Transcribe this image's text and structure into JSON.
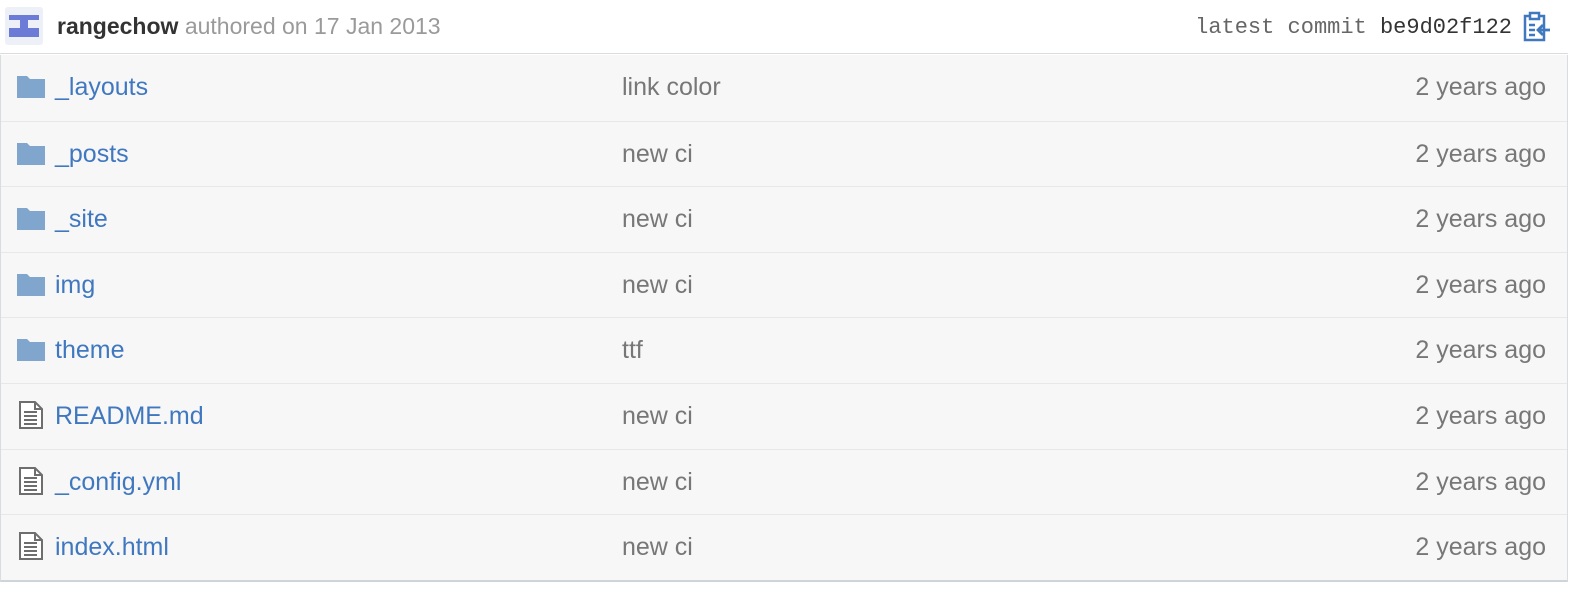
{
  "commit": {
    "author": "rangechow",
    "authored_text": "authored on 17 Jan 2013",
    "latest_label": "latest commit",
    "sha": "be9d02f122",
    "copy_icon": "clipboard-icon"
  },
  "files": [
    {
      "type": "folder",
      "icon": "folder-icon",
      "name": "_layouts",
      "message": "link color",
      "age": "2 years ago"
    },
    {
      "type": "folder",
      "icon": "folder-icon",
      "name": "_posts",
      "message": "new ci",
      "age": "2 years ago"
    },
    {
      "type": "folder",
      "icon": "folder-icon",
      "name": "_site",
      "message": "new ci",
      "age": "2 years ago"
    },
    {
      "type": "folder",
      "icon": "folder-icon",
      "name": "img",
      "message": "new ci",
      "age": "2 years ago"
    },
    {
      "type": "folder",
      "icon": "folder-icon",
      "name": "theme",
      "message": "ttf",
      "age": "2 years ago"
    },
    {
      "type": "file",
      "icon": "file-text-icon",
      "name": "README.md",
      "message": "new ci",
      "age": "2 years ago"
    },
    {
      "type": "file",
      "icon": "file-text-icon",
      "name": "_config.yml",
      "message": "new ci",
      "age": "2 years ago"
    },
    {
      "type": "file",
      "icon": "file-text-icon",
      "name": "index.html",
      "message": "new ci",
      "age": "2 years ago"
    }
  ],
  "colors": {
    "link": "#4078c0",
    "folder": "#80a6cd",
    "row_background": "#f7f7f7",
    "muted_text": "#777777"
  }
}
